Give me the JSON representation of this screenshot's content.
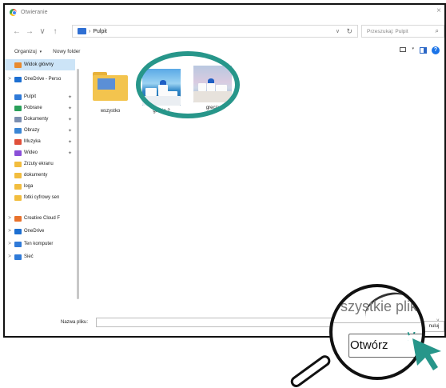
{
  "window": {
    "title": "Otwieranie",
    "close_glyph": "×"
  },
  "nav": {
    "back_glyph": "←",
    "forward_glyph": "→",
    "recent_glyph": "∨",
    "up_glyph": "↑",
    "breadcrumb_sep": "›",
    "breadcrumb": "Pulpit",
    "address_dropdown_glyph": "∨",
    "refresh_glyph": "↻",
    "search_placeholder": "Przeszukaj: Pulpit",
    "search_glyph": "⌕"
  },
  "commands": {
    "organize": "Organizuj",
    "organize_dd": "▾",
    "new_folder": "Nowy folder",
    "view_dd": "▾",
    "help": "?"
  },
  "sidebar": {
    "pin_glyph": "✦",
    "items": [
      {
        "label": "Widok główny",
        "icon": "home-icon",
        "color": "#e88a2e",
        "selected": true,
        "chevron": ""
      },
      {
        "label": "OneDrive - Perso",
        "icon": "cloud-icon",
        "color": "#1d6fd1",
        "selected": false,
        "chevron": ">"
      },
      {
        "label": "Pulpit",
        "icon": "desktop-icon",
        "color": "#2f7ad8",
        "pinned": true
      },
      {
        "label": "Pobrane",
        "icon": "download-icon",
        "color": "#2aa05a",
        "pinned": true
      },
      {
        "label": "Dokumenty",
        "icon": "documents-icon",
        "color": "#7c8fb0",
        "pinned": true
      },
      {
        "label": "Obrazy",
        "icon": "pictures-icon",
        "color": "#3a86d4",
        "pinned": true
      },
      {
        "label": "Muzyka",
        "icon": "music-icon",
        "color": "#e0503a",
        "pinned": true
      },
      {
        "label": "Wideo",
        "icon": "video-icon",
        "color": "#8a4fd8",
        "pinned": true
      },
      {
        "label": "Zrzuty ekranu",
        "icon": "folder-icon",
        "color": "#f2bd3e"
      },
      {
        "label": "dokumenty",
        "icon": "folder-icon",
        "color": "#f2bd3e"
      },
      {
        "label": "loga",
        "icon": "folder-icon",
        "color": "#f2bd3e"
      },
      {
        "label": "fotki cyfrowy sen",
        "icon": "folder-icon",
        "color": "#f2bd3e"
      },
      {
        "label": "Creative Cloud F",
        "icon": "creative-cloud-icon",
        "color": "#e8722c",
        "chevron": ">"
      },
      {
        "label": "OneDrive",
        "icon": "cloud-icon",
        "color": "#1d6fd1",
        "chevron": ">"
      },
      {
        "label": "Ten komputer",
        "icon": "computer-icon",
        "color": "#2f7ad8",
        "chevron": ">"
      },
      {
        "label": "Sieć",
        "icon": "network-icon",
        "color": "#2f7ad8",
        "chevron": ">"
      }
    ]
  },
  "files": [
    {
      "name": "wszystko",
      "type": "folder"
    },
    {
      "name": "grecja 2",
      "type": "image"
    },
    {
      "name": "grecja",
      "type": "image"
    }
  ],
  "footer": {
    "filename_label": "Nazwa pliku:",
    "filename_value": "",
    "filter_dropdown_glyph": "∨",
    "cancel_partial": "nuluj",
    "magnified_filter": "szystkie plik",
    "magnified_open": "Otwórz"
  },
  "accent": "#27968a"
}
